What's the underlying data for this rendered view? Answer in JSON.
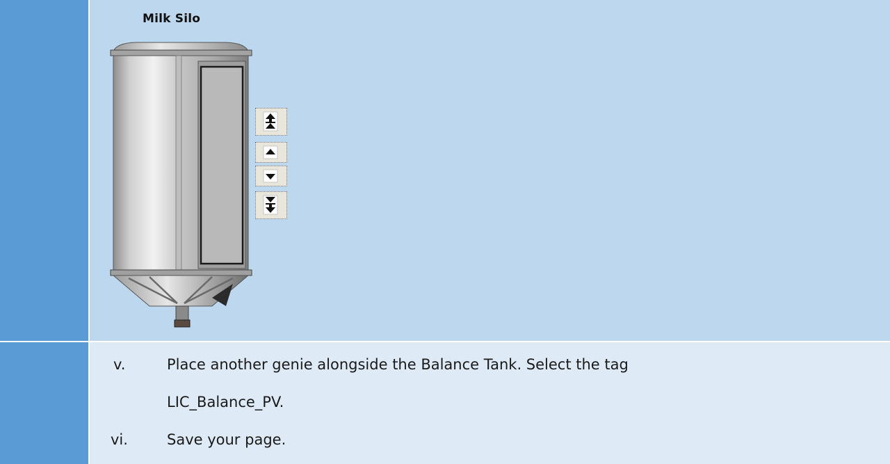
{
  "figure": {
    "title": "Milk Silo",
    "controls": [
      {
        "icon": "double-up-arrow-icon"
      },
      {
        "icon": "up-arrow-icon"
      },
      {
        "icon": "down-arrow-icon"
      },
      {
        "icon": "double-down-arrow-icon"
      }
    ]
  },
  "steps": [
    {
      "number": "v.",
      "line1": "Place another genie alongside the Balance Tank. Select the tag",
      "line2": "LIC_Balance_PV."
    },
    {
      "number": "vi.",
      "line1": "Save your page."
    }
  ],
  "colors": {
    "left_column": "#5b9bd5",
    "figure_cell": "#bdd7ee",
    "text_cell": "#deeaf6"
  }
}
